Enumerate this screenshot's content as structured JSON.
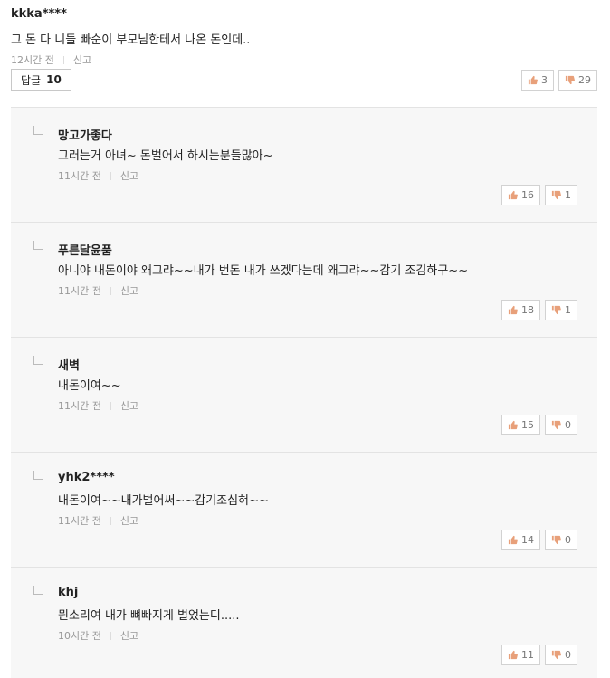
{
  "top_comment": {
    "author": "kkka****",
    "content": "그 돈 다 니들 빠순이 부모님한테서 나온 돈인데..",
    "time": "12시간 전",
    "report_label": "신고",
    "reply_label": "답글",
    "reply_count": "10",
    "likes": "3",
    "dislikes": "29"
  },
  "replies": [
    {
      "author": "망고가좋다",
      "content": "그러는거 아녀~ 돈벌어서 하시는분들많아~",
      "time": "11시간 전",
      "report_label": "신고",
      "likes": "16",
      "dislikes": "1"
    },
    {
      "author": "푸른달윤품",
      "content": "아니야 내돈이야 왜그랴~~내가 번돈 내가 쓰겠다는데 왜그랴~~감기 조김하구~~",
      "time": "11시간 전",
      "report_label": "신고",
      "likes": "18",
      "dislikes": "1"
    },
    {
      "author": "새벽",
      "content": "내돈이여~~",
      "time": "11시간 전",
      "report_label": "신고",
      "likes": "15",
      "dislikes": "0"
    },
    {
      "author": "yhk2****",
      "content": "내돈이여~~내가벌어써~~감기조심혀~~",
      "time": "11시간 전",
      "report_label": "신고",
      "likes": "14",
      "dislikes": "0"
    },
    {
      "author": "khj",
      "content": "뭔소리여 내가 뼈빠지게 벌었는디.....",
      "time": "10시간 전",
      "report_label": "신고",
      "likes": "11",
      "dislikes": "0"
    }
  ],
  "icons": {
    "like": "thumbs-up-icon",
    "dislike": "thumbs-down-icon",
    "reply_indent": "reply-arrow-icon"
  },
  "colors": {
    "thumb": "#e8a07a",
    "border": "#d2d2d2",
    "reply_bg": "#f7f7f7"
  }
}
